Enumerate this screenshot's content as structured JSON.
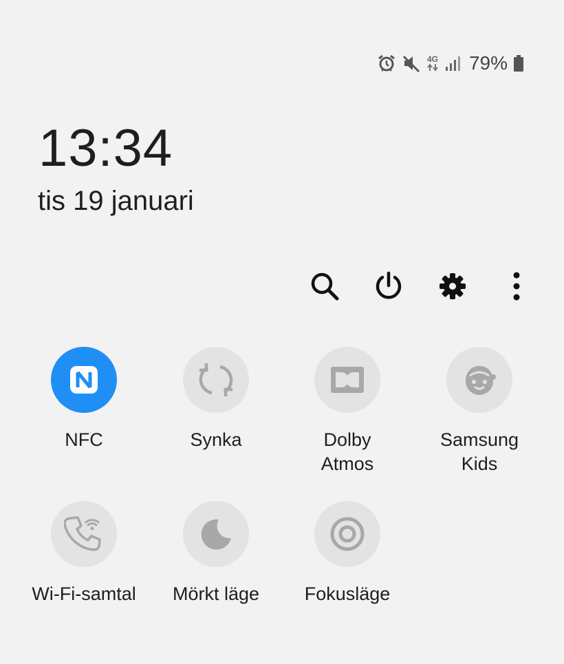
{
  "status_bar": {
    "icons": [
      "alarm-icon",
      "mute-icon",
      "network-4g-icon",
      "signal-icon",
      "battery-icon"
    ],
    "network_label": "4G",
    "battery_percent": "79%"
  },
  "clock": {
    "time": "13:34",
    "date": "tis 19 januari"
  },
  "header_actions": [
    "search-icon",
    "power-icon",
    "settings-icon",
    "more-options-icon"
  ],
  "tiles": [
    {
      "label": "NFC",
      "icon": "nfc-icon",
      "active": true
    },
    {
      "label": "Synka",
      "icon": "sync-icon",
      "active": false
    },
    {
      "label_line1": "Dolby",
      "label_line2": "Atmos",
      "icon": "dolby-atmos-icon",
      "active": false
    },
    {
      "label_line1": "Samsung",
      "label_line2": "Kids",
      "icon": "samsung-kids-icon",
      "active": false
    },
    {
      "label": "Wi-Fi-samtal",
      "icon": "wifi-calling-icon",
      "active": false
    },
    {
      "label": "Mörkt läge",
      "icon": "dark-mode-icon",
      "active": false
    },
    {
      "label": "Fokusläge",
      "icon": "focus-mode-icon",
      "active": false
    }
  ],
  "colors": {
    "active_tile": "#1f8ff5",
    "inactive_tile": "#e3e3e3",
    "inactive_icon": "#a8a8a8"
  }
}
